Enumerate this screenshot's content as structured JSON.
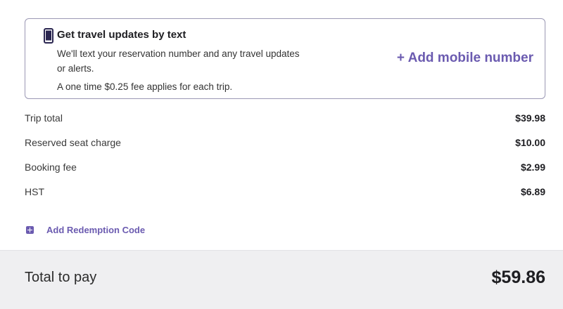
{
  "sms_card": {
    "title": "Get travel updates by text",
    "description": "We'll text your reservation number and any travel updates or alerts.",
    "fee_note": "A one time $0.25 fee applies for each trip.",
    "add_mobile_label": "+ Add mobile number",
    "icon": "mobile-phone-icon"
  },
  "summary": {
    "lines": [
      {
        "label": "Trip total",
        "amount": "$39.98"
      },
      {
        "label": "Reserved seat charge",
        "amount": "$10.00"
      },
      {
        "label": "Booking fee",
        "amount": "$2.99"
      },
      {
        "label": "HST",
        "amount": "$6.89"
      }
    ]
  },
  "redemption": {
    "label": "Add Redemption Code",
    "icon": "plus-square-icon"
  },
  "total": {
    "label": "Total to pay",
    "amount": "$59.86"
  },
  "colors": {
    "accent": "#6b5bb0",
    "total_bar_bg": "#efeff1",
    "card_border": "#9b98b4"
  }
}
